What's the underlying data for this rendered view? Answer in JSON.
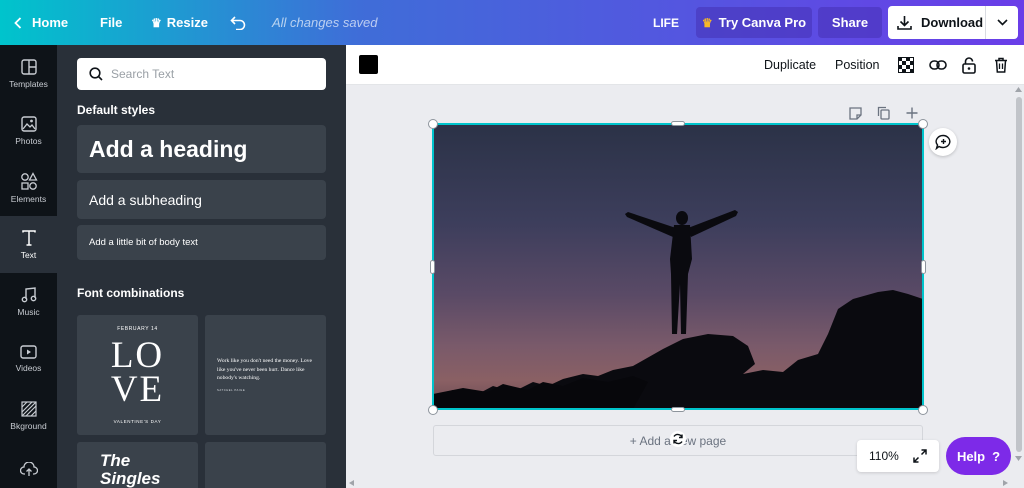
{
  "topbar": {
    "home_label": "Home",
    "file_label": "File",
    "resize_label": "Resize",
    "saved_status": "All changes saved",
    "doc_title": "LIFE",
    "pro_label": "Try Canva Pro",
    "share_label": "Share",
    "download_label": "Download"
  },
  "nav": {
    "items": [
      {
        "label": "Templates",
        "icon": "templates-icon"
      },
      {
        "label": "Photos",
        "icon": "photos-icon"
      },
      {
        "label": "Elements",
        "icon": "elements-icon"
      },
      {
        "label": "Text",
        "icon": "text-icon",
        "active": true
      },
      {
        "label": "Music",
        "icon": "music-icon"
      },
      {
        "label": "Videos",
        "icon": "videos-icon"
      },
      {
        "label": "Bkground",
        "icon": "background-icon"
      }
    ]
  },
  "panel": {
    "search_placeholder": "Search Text",
    "default_styles_title": "Default styles",
    "heading_label": "Add a heading",
    "subheading_label": "Add a subheading",
    "body_label": "Add a little bit of body text",
    "font_combos_title": "Font combinations",
    "combo1": {
      "date": "FEBRUARY 14",
      "line1": "LO",
      "line2": "VE",
      "footer": "VALENTINE'S DAY"
    },
    "combo2": {
      "quote": "Work like you don't need the money. Love like you've never been hurt. Dance like nobody's watching.",
      "author": "SATCHEL PAIGE"
    },
    "combo3": {
      "line1": "The",
      "line2": "Singles"
    }
  },
  "toolbar": {
    "color": "#000000",
    "duplicate_label": "Duplicate",
    "position_label": "Position"
  },
  "canvas": {
    "add_page_label": "+ Add a new page",
    "zoom_label": "110%",
    "help_label": "Help",
    "help_icon": "?"
  },
  "colors": {
    "accent_teal": "#00c4cc",
    "accent_purple": "#7d2ae8",
    "panel_bg": "#293039",
    "nav_bg": "#0e1318"
  }
}
